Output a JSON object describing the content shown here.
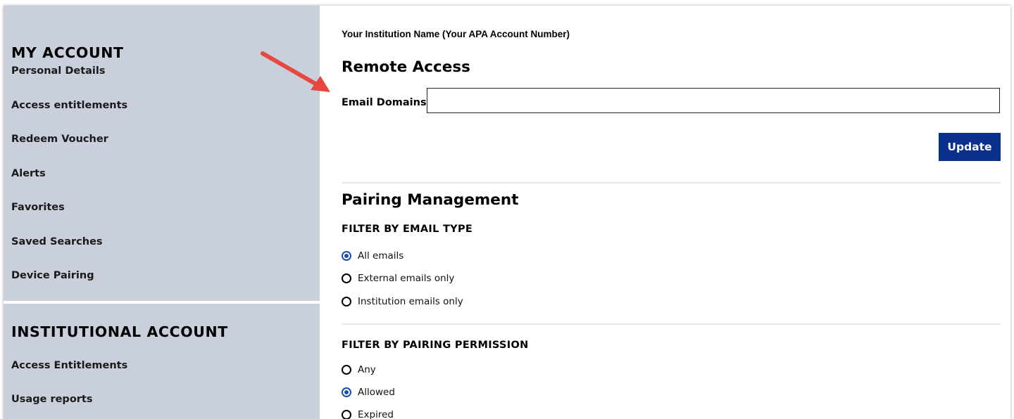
{
  "sidebar": {
    "my_account": {
      "title": "MY ACCOUNT",
      "items": [
        {
          "label": "Personal Details"
        },
        {
          "label": "Access entitlements"
        },
        {
          "label": "Redeem Voucher"
        },
        {
          "label": "Alerts"
        },
        {
          "label": "Favorites"
        },
        {
          "label": "Saved Searches"
        },
        {
          "label": "Device Pairing"
        }
      ]
    },
    "institutional_account": {
      "title": "INSTITUTIONAL ACCOUNT",
      "items": [
        {
          "label": "Access Entitlements"
        },
        {
          "label": "Usage reports"
        }
      ]
    }
  },
  "main": {
    "institution_name": "Your Institution Name (Your APA Account Number)",
    "remote_access": {
      "title": "Remote Access",
      "email_domains_label": "Email Domains",
      "email_domains_value": "",
      "update_label": "Update"
    },
    "pairing": {
      "title": "Pairing Management",
      "filter_email": {
        "title": "FILTER BY EMAIL TYPE",
        "options": [
          {
            "label": "All emails",
            "checked": true
          },
          {
            "label": "External emails only",
            "checked": false
          },
          {
            "label": "Institution emails only",
            "checked": false
          }
        ]
      },
      "filter_permission": {
        "title": "FILTER BY PAIRING PERMISSION",
        "options": [
          {
            "label": "Any",
            "checked": false
          },
          {
            "label": "Allowed",
            "checked": true
          },
          {
            "label": "Expired",
            "checked": false
          }
        ]
      }
    }
  },
  "colors": {
    "sidebar_bg": "#c9cfdb",
    "button_bg": "#0a2f8c",
    "radio_checked": "#1a4db3",
    "arrow": "#e8473f"
  }
}
